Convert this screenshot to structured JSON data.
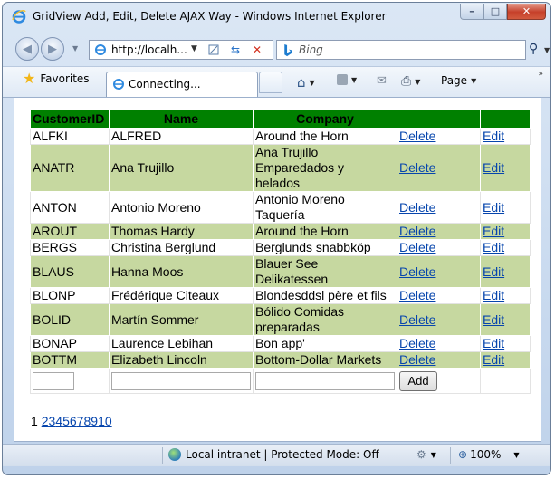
{
  "window": {
    "title": "GridView Add, Edit, Delete AJAX Way - Windows Internet Explorer",
    "caption_buttons": {
      "minimize": "–",
      "maximize": "□",
      "close": "✕"
    }
  },
  "addressbar": {
    "url": "http://localh...",
    "search_placeholder": "Bing"
  },
  "toolbar": {
    "favorites_label": "Favorites",
    "tab_title": "Connecting...",
    "page_label": "Page"
  },
  "grid": {
    "headers": [
      "CustomerID",
      "Name",
      "Company",
      "",
      ""
    ],
    "header_color": "#008000",
    "alt_row_color": "#c6d8a0",
    "delete_label": "Delete",
    "edit_label": "Edit",
    "rows": [
      {
        "id": "ALFKI",
        "name": "ALFRED",
        "company": [
          "Around the Horn"
        ],
        "alt": false
      },
      {
        "id": "ANATR",
        "name": "Ana Trujillo",
        "company": [
          "Ana Trujillo",
          "Emparedados y",
          "helados"
        ],
        "alt": true
      },
      {
        "id": "ANTON",
        "name": "Antonio Moreno",
        "company": [
          "Antonio Moreno",
          "Taquería"
        ],
        "alt": false
      },
      {
        "id": "AROUT",
        "name": "Thomas Hardy",
        "company": [
          "Around the Horn"
        ],
        "alt": true
      },
      {
        "id": "BERGS",
        "name": "Christina Berglund",
        "company": [
          "Berglunds snabbköp"
        ],
        "alt": false
      },
      {
        "id": "BLAUS",
        "name": "Hanna Moos",
        "company": [
          "Blauer See",
          "Delikatessen"
        ],
        "alt": true
      },
      {
        "id": "BLONP",
        "name": "Frédérique Citeaux",
        "company": [
          "Blondesddsl père et fils"
        ],
        "alt": false
      },
      {
        "id": "BOLID",
        "name": "Martín Sommer",
        "company": [
          "Bólido Comidas",
          "preparadas"
        ],
        "alt": true
      },
      {
        "id": "BONAP",
        "name": "Laurence Lebihan",
        "company": [
          "Bon app'"
        ],
        "alt": false
      },
      {
        "id": "BOTTM",
        "name": "Elizabeth Lincoln",
        "company": [
          "Bottom-Dollar Markets"
        ],
        "alt": true
      }
    ],
    "insert_row": {
      "id_value": "",
      "name_value": "",
      "company_value": "",
      "add_label": "Add"
    },
    "pager": {
      "current": "1",
      "pages": [
        "2",
        "3",
        "4",
        "5",
        "6",
        "7",
        "8",
        "9",
        "10"
      ]
    }
  },
  "statusbar": {
    "zone_text": "Local intranet | Protected Mode: Off",
    "zoom": "100%"
  }
}
